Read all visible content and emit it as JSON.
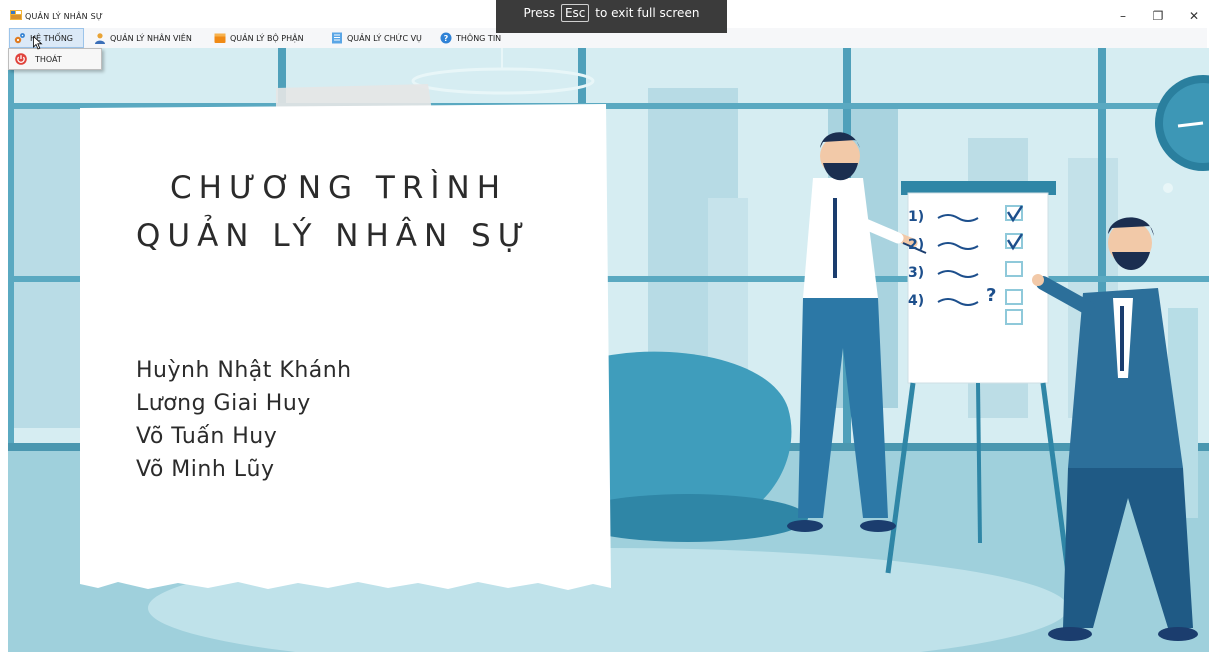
{
  "window": {
    "title": "QUẢN LÝ NHÂN SỰ",
    "controls": {
      "minimize": "–",
      "maximize": "❐",
      "close": "✕"
    }
  },
  "fullscreen_notice": {
    "before": "Press",
    "key": "Esc",
    "after": "to exit full screen"
  },
  "menu": {
    "items": [
      {
        "label": "HỆ THỐNG",
        "icon": "gears-icon"
      },
      {
        "label": "QUẢN LÝ NHÂN VIÊN",
        "icon": "user-icon"
      },
      {
        "label": "QUẢN LÝ BỘ PHẬN",
        "icon": "folder-icon"
      },
      {
        "label": "QUẢN LÝ CHỨC VỤ",
        "icon": "list-icon"
      },
      {
        "label": "THÔNG TIN",
        "icon": "info-icon"
      }
    ],
    "dropdown": [
      {
        "label": "THOÁT",
        "icon": "power-icon"
      }
    ]
  },
  "card": {
    "title_line1": "CHƯƠNG TRÌNH",
    "title_line2": "QUẢN LÝ NHÂN SỰ",
    "authors": [
      "Huỳnh Nhật Khánh",
      "Lương Giai Huy",
      "Võ Tuấn Huy",
      "Võ Minh Lũy"
    ]
  },
  "flipchart": {
    "items": [
      "1)",
      "2)",
      "3)",
      "4)"
    ],
    "question_mark": "?"
  },
  "colors": {
    "scene_bg": "#cfe9ef",
    "window_frame": "#5fa8c0",
    "suit_blue": "#2c6f9a",
    "paper": "#ffffff"
  }
}
